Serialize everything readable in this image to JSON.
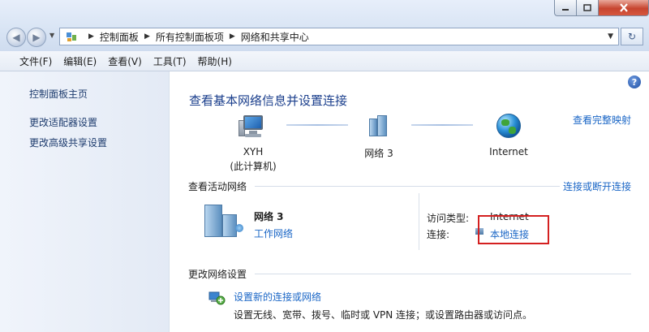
{
  "window": {
    "controls": {
      "minimize": "–",
      "maximize": "□",
      "close": "✕"
    }
  },
  "address_bar": {
    "breadcrumbs": [
      "控制面板",
      "所有控制面板项",
      "网络和共享中心"
    ],
    "refresh_icon": "refresh-icon"
  },
  "menu": {
    "items": [
      "文件(F)",
      "编辑(E)",
      "查看(V)",
      "工具(T)",
      "帮助(H)"
    ]
  },
  "sidebar": {
    "items": [
      {
        "label": "控制面板主页"
      },
      {
        "label": "更改适配器设置"
      },
      {
        "label": "更改高级共享设置"
      }
    ]
  },
  "main": {
    "help": "?",
    "title": "查看基本网络信息并设置连接",
    "full_map": "查看完整映射",
    "map": {
      "computer": {
        "name": "XYH",
        "sub": "(此计算机)"
      },
      "network": {
        "name": "网络  3"
      },
      "internet": {
        "name": "Internet"
      }
    },
    "active_networks": {
      "heading": "查看活动网络",
      "connect_link": "连接或断开连接",
      "network_name": "网络  3",
      "network_type": "工作网络",
      "access_type_label": "访问类型:",
      "access_type_value": "Internet",
      "connection_label": "连接:",
      "connection_value": "本地连接"
    },
    "change_settings": {
      "heading": "更改网络设置",
      "task_title": "设置新的连接或网络",
      "task_desc": "设置无线、宽带、拨号、临时或 VPN 连接；或设置路由器或访问点。"
    }
  },
  "colors": {
    "link": "#1a66c6",
    "title": "#1a3e8c",
    "highlight_box": "#d42020"
  }
}
